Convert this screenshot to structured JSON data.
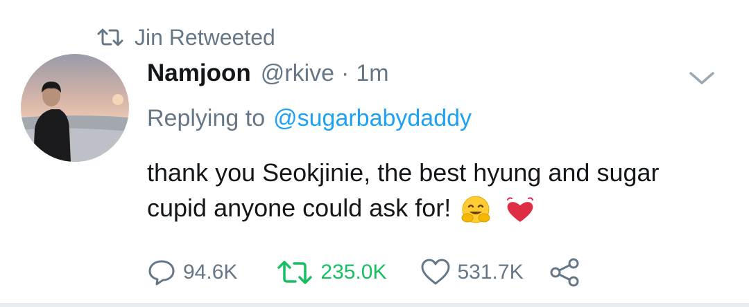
{
  "retweet_context": {
    "label": "Jin Retweeted",
    "icon": "retweet-icon"
  },
  "tweet": {
    "author_name": "Namjoon",
    "author_handle": "@rkive",
    "separator": "·",
    "timestamp": "1m",
    "reply_prefix": "Replying to",
    "reply_to": "@sugarbabydaddy",
    "text": "thank you Seokjinie, the best hyung and sugar cupid anyone could ask for!",
    "emojis": [
      "hugging-face-emoji",
      "heart-emoji"
    ]
  },
  "actions": {
    "reply_count": "94.6K",
    "retweet_count": "235.0K",
    "like_count": "531.7K",
    "icons": [
      "reply-icon",
      "retweet-icon",
      "like-icon",
      "share-icon"
    ]
  },
  "colors": {
    "secondary_text": "#657786",
    "primary_text": "#14171a",
    "link": "#1da1f2",
    "retweet_active": "#17bf63",
    "heart": "#e0245e"
  }
}
